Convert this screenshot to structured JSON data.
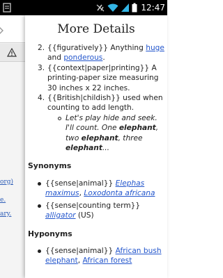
{
  "status_bar": {
    "time": "12:47"
  },
  "background_page": {
    "links": [
      "org)",
      "e.",
      "ary."
    ]
  },
  "drawer": {
    "title": "More Details",
    "top_partial_text": "{{figuratively}} Anything",
    "definitions": [
      {
        "number": "2.",
        "prefix": "{{figuratively}} Anything ",
        "link1": "huge",
        "middle": " and ",
        "link2": "ponderous",
        "suffix": "."
      },
      {
        "number": "3.",
        "text": "{{context|paper|printing}} A printing-paper size measuring 30 inches x 22 inches."
      },
      {
        "number": "4.",
        "text": "{{British|childish}} used when counting to add length.",
        "example": {
          "part1": "Let's play hide and seek. I'll count. One ",
          "b1": "elephant",
          "part2": ", two ",
          "b2": "elephant",
          "part3": ", three ",
          "b3": "elephant",
          "part4": "..."
        }
      }
    ],
    "synonyms": {
      "heading": "Synonyms",
      "items": [
        {
          "prefix": "{{sense|animal}} ",
          "link1": "Elephas maximus",
          "sep": ", ",
          "link2": "Loxodonta africana"
        },
        {
          "prefix": "{{sense|counting term}} ",
          "link1": "alligator",
          "suffix": " (US)"
        }
      ]
    },
    "hyponyms": {
      "heading": "Hyponyms",
      "items": [
        {
          "prefix": "{{sense|animal}} ",
          "link1": "African bush elephant",
          "sep": ", ",
          "link2": "African forest"
        }
      ]
    }
  },
  "colors": {
    "link": "#2255cc",
    "status_bar": "#000000",
    "wifi_signal": "#33b5e5"
  },
  "icons": [
    "no-signal-icon",
    "wifi-icon",
    "cell-signal-icon",
    "battery-icon",
    "warning-icon",
    "chevron-icon",
    "notification-icon"
  ]
}
